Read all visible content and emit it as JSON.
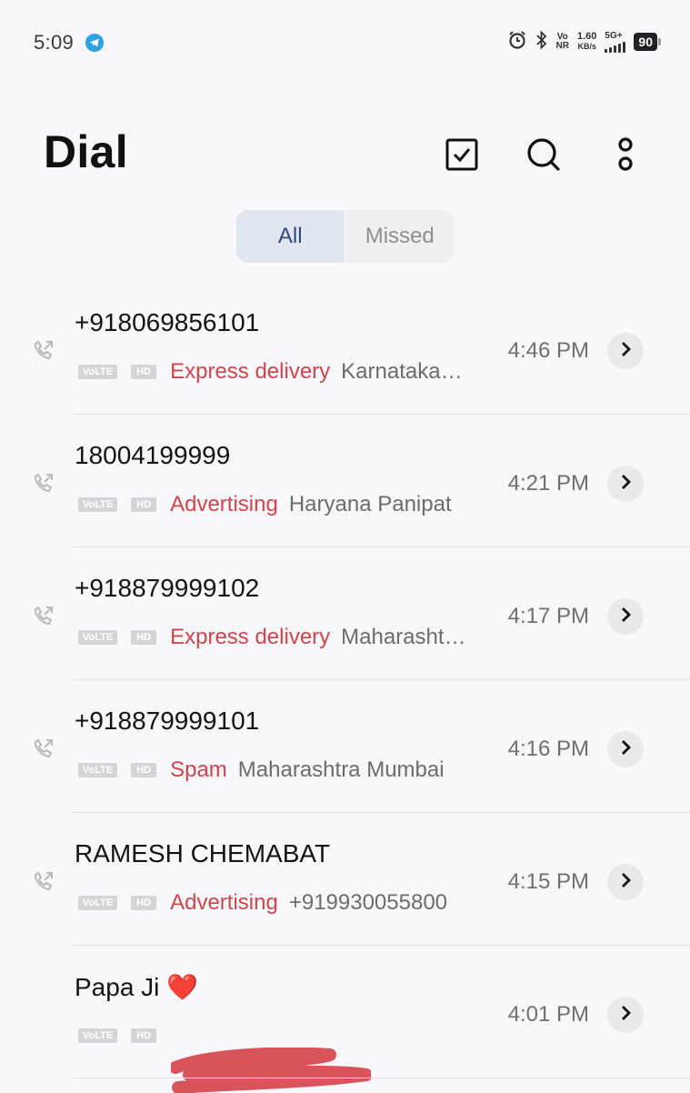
{
  "status_bar": {
    "time": "5:09",
    "telegram_icon": "telegram-icon",
    "alarm_icon": "alarm-icon",
    "bluetooth_icon": "bluetooth-icon",
    "vonr_top": "Vo",
    "vonr_bottom": "NR",
    "speed_value": "1.60",
    "speed_unit": "KB/s",
    "network": "5G+",
    "battery": "90"
  },
  "header": {
    "title": "Dial",
    "select_icon": "checkbox-icon",
    "search_icon": "search-icon",
    "more_icon": "more-vertical-icon"
  },
  "tabs": [
    {
      "label": "All",
      "active": true
    },
    {
      "label": "Missed",
      "active": false
    }
  ],
  "calls": [
    {
      "name": "+918069856101",
      "volte": "VoLTE",
      "hd": "HD",
      "tag": "Express delivery",
      "location": "Karnataka…",
      "time": "4:46 PM"
    },
    {
      "name": "18004199999",
      "volte": "VoLTE",
      "hd": "HD",
      "tag": "Advertising",
      "location": "Haryana Panipat",
      "time": "4:21 PM"
    },
    {
      "name": "+918879999102",
      "volte": "VoLTE",
      "hd": "HD",
      "tag": "Express delivery",
      "location": "Maharasht…",
      "time": "4:17 PM"
    },
    {
      "name": "+918879999101",
      "volte": "VoLTE",
      "hd": "HD",
      "tag": "Spam",
      "location": "Maharashtra Mumbai",
      "time": "4:16 PM"
    },
    {
      "name": "RAMESH CHEMABAT",
      "volte": "VoLTE",
      "hd": "HD",
      "tag": "Advertising",
      "location": "+919930055800",
      "time": "4:15 PM"
    },
    {
      "name": "Papa Ji ❤️",
      "volte": "VoLTE",
      "hd": "HD",
      "tag": "",
      "location": "",
      "time": "4:01 PM"
    }
  ],
  "colors": {
    "background": "#f8f7fb",
    "tag_red": "#d1454a",
    "tab_active_bg": "#e2e6ef",
    "tab_active_text": "#2e4a86",
    "redaction": "#d9545a"
  }
}
